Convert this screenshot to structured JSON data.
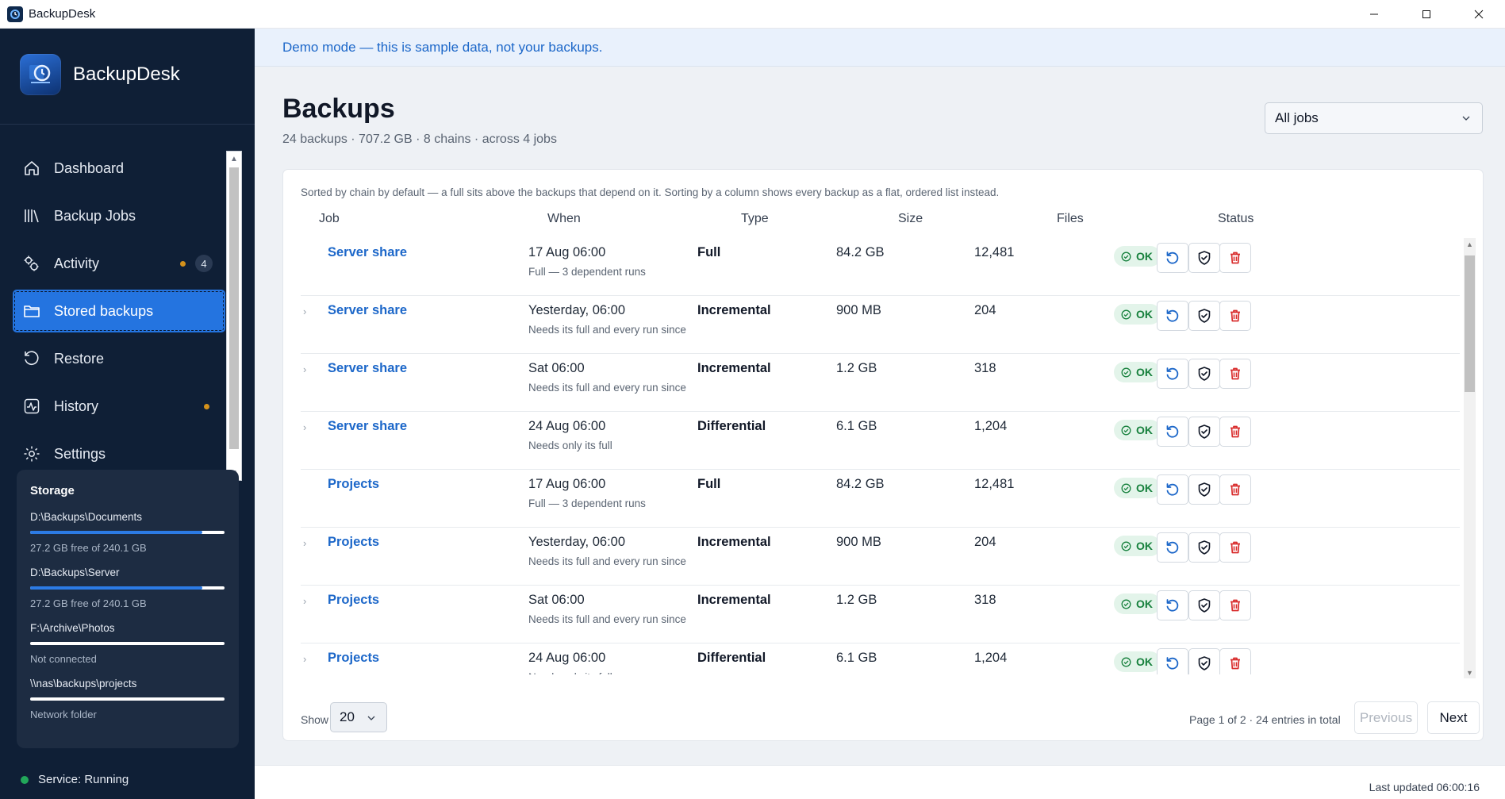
{
  "window": {
    "title": "BackupDesk"
  },
  "brand": {
    "name": "BackupDesk",
    "logo_text": "BackupDesk"
  },
  "nav": [
    {
      "label": "Dashboard",
      "icon": "home-icon"
    },
    {
      "label": "Backup Jobs",
      "icon": "library-icon"
    },
    {
      "label": "Activity",
      "icon": "activity-gears-icon",
      "dot": true,
      "count": "4"
    },
    {
      "label": "Stored backups",
      "icon": "folder-icon",
      "active": true
    },
    {
      "label": "Restore",
      "icon": "restore-icon"
    },
    {
      "label": "History",
      "icon": "history-pulse-icon",
      "dot": true
    },
    {
      "label": "Settings",
      "icon": "gear-icon"
    }
  ],
  "storage": {
    "title": "Storage",
    "volumes": [
      {
        "path": "D:\\Backups\\Documents",
        "detail": "27.2 GB free of 240.1 GB",
        "used_fraction": 0.887
      },
      {
        "path": "D:\\Backups\\Server",
        "detail": "27.2 GB free of 240.1 GB",
        "used_fraction": 0.887
      },
      {
        "path": "F:\\Archive\\Photos",
        "detail": "Not connected",
        "used_fraction": 0
      },
      {
        "path": "\\\\nas\\backups\\projects",
        "detail": "Network folder",
        "used_fraction": 0
      }
    ]
  },
  "service": {
    "status": "Service: Running",
    "color": "#22a75a"
  },
  "banner": {
    "text": "Demo mode — this is sample data, not your backups."
  },
  "page": {
    "title": "Backups",
    "subtitle": "24 backups · 707.2 GB · 8 chains · across 4 jobs",
    "job_filter": "All jobs"
  },
  "table": {
    "note": "Sorted by chain by default — a full sits above the backups that depend on it. Sorting by a column shows every backup as a flat, ordered list instead.",
    "columns": {
      "job": "Job",
      "when": "When",
      "type": "Type",
      "size": "Size",
      "files": "Files",
      "status": "Status"
    },
    "rows": [
      {
        "expandable": false,
        "job": "Server share",
        "when": "17 Aug 06:00",
        "when_sub": "Full — 3 dependent runs",
        "type": "Full",
        "size": "84.2 GB",
        "files": "12,481",
        "status": "OK"
      },
      {
        "expandable": true,
        "job": "Server share",
        "when": "Yesterday, 06:00",
        "when_sub": "Needs its full and every run since",
        "type": "Incremental",
        "size": "900 MB",
        "files": "204",
        "status": "OK"
      },
      {
        "expandable": true,
        "job": "Server share",
        "when": "Sat 06:00",
        "when_sub": "Needs its full and every run since",
        "type": "Incremental",
        "size": "1.2 GB",
        "files": "318",
        "status": "OK"
      },
      {
        "expandable": true,
        "job": "Server share",
        "when": "24 Aug 06:00",
        "when_sub": "Needs only its full",
        "type": "Differential",
        "size": "6.1 GB",
        "files": "1,204",
        "status": "OK"
      },
      {
        "expandable": false,
        "job": "Projects",
        "when": "17 Aug 06:00",
        "when_sub": "Full — 3 dependent runs",
        "type": "Full",
        "size": "84.2 GB",
        "files": "12,481",
        "status": "OK"
      },
      {
        "expandable": true,
        "job": "Projects",
        "when": "Yesterday, 06:00",
        "when_sub": "Needs its full and every run since",
        "type": "Incremental",
        "size": "900 MB",
        "files": "204",
        "status": "OK"
      },
      {
        "expandable": true,
        "job": "Projects",
        "when": "Sat 06:00",
        "when_sub": "Needs its full and every run since",
        "type": "Incremental",
        "size": "1.2 GB",
        "files": "318",
        "status": "OK"
      },
      {
        "expandable": true,
        "job": "Projects",
        "when": "24 Aug 06:00",
        "when_sub": "Needs only its full",
        "type": "Differential",
        "size": "6.1 GB",
        "files": "1,204",
        "status": "OK"
      }
    ]
  },
  "pagination": {
    "show_label": "Show",
    "per_page": "20",
    "info": "Page 1 of 2 · 24 entries in total",
    "previous": "Previous",
    "next": "Next"
  },
  "statusbar": {
    "updated": "Last updated 06:00:16"
  },
  "colors": {
    "accent": "#2474e0",
    "link": "#1c67c9",
    "ok": "#16803c",
    "danger": "#d92d2d",
    "sidebar": "#0f1f36"
  }
}
